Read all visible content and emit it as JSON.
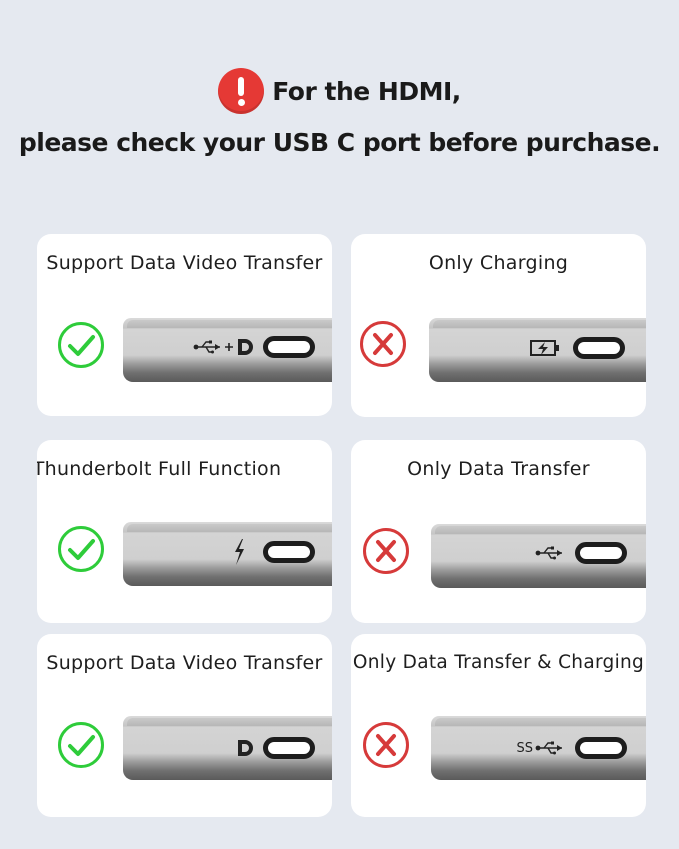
{
  "header": {
    "line1": "For the HDMI,",
    "line2": "please check your USB C port before purchase."
  },
  "cards": [
    {
      "title": "Support Data Video Transfer",
      "status": "check-icon",
      "port_symbols": [
        "usb-icon",
        "plus-icon",
        "displayport-icon"
      ]
    },
    {
      "title": "Only Charging",
      "status": "cross-icon",
      "port_symbols": [
        "charging-icon"
      ]
    },
    {
      "title": "Thunderbolt Full Function",
      "status": "check-icon",
      "port_symbols": [
        "thunderbolt-icon"
      ]
    },
    {
      "title": "Only Data Transfer",
      "status": "cross-icon",
      "port_symbols": [
        "usb-icon"
      ]
    },
    {
      "title": "Support Data Video Transfer",
      "status": "check-icon",
      "port_symbols": [
        "displayport-icon"
      ]
    },
    {
      "title": "Only Data Transfer & Charging",
      "status": "cross-icon",
      "port_symbols": [
        "ss-usb-icon"
      ],
      "port_text": "SS"
    }
  ],
  "colors": {
    "background": "#e5e9f0",
    "check": "#2ecc3a",
    "cross": "#d63a3a",
    "warning": "#e53935"
  }
}
